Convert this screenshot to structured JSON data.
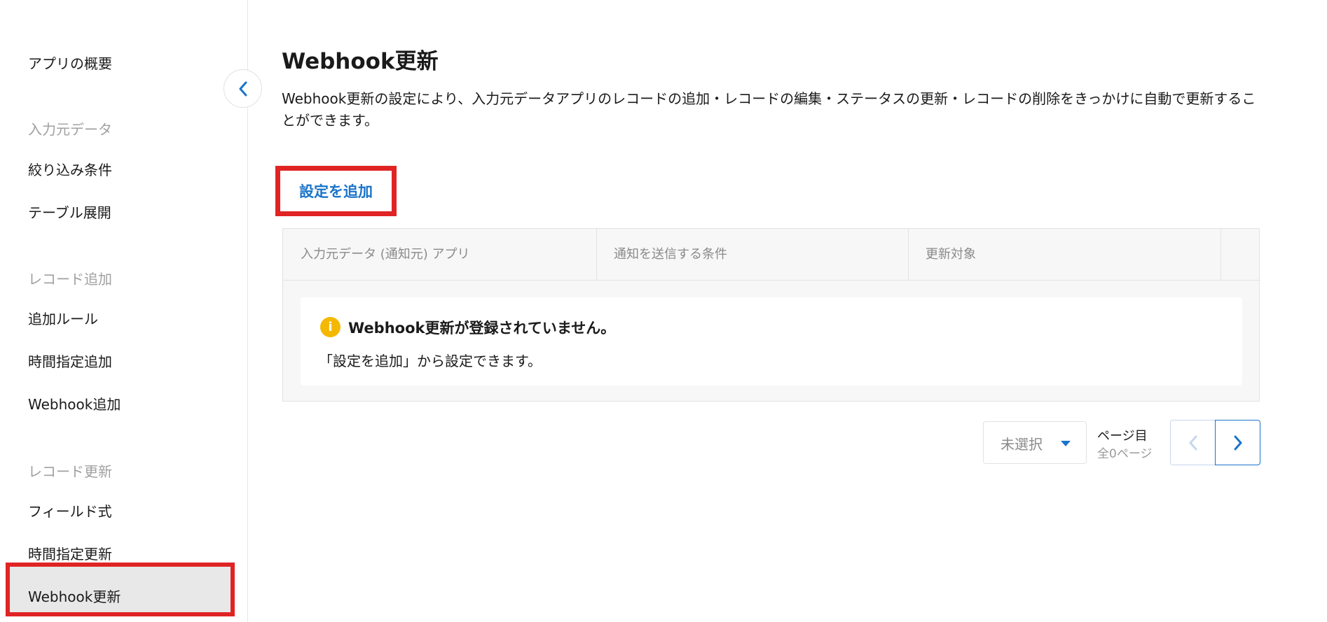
{
  "sidebar": {
    "items": [
      {
        "label": "アプリの概要",
        "type": "item"
      },
      {
        "label": "入力元データ",
        "type": "section"
      },
      {
        "label": "絞り込み条件",
        "type": "item"
      },
      {
        "label": "テーブル展開",
        "type": "item"
      },
      {
        "label": "レコード追加",
        "type": "section"
      },
      {
        "label": "追加ルール",
        "type": "item"
      },
      {
        "label": "時間指定追加",
        "type": "item"
      },
      {
        "label": "Webhook追加",
        "type": "item"
      },
      {
        "label": "レコード更新",
        "type": "section"
      },
      {
        "label": "フィールド式",
        "type": "item"
      },
      {
        "label": "時間指定更新",
        "type": "item"
      },
      {
        "label": "Webhook更新",
        "type": "item",
        "active": true
      }
    ]
  },
  "main": {
    "title": "Webhook更新",
    "description": "Webhook更新の設定により、入力元データアプリのレコードの追加・レコードの編集・ステータスの更新・レコードの削除をきっかけに自動で更新することができます。",
    "add_button_label": "設定を追加",
    "table": {
      "columns": [
        "入力元データ (通知元) アプリ",
        "通知を送信する条件",
        "更新対象"
      ],
      "empty_title": "Webhook更新が登録されていません。",
      "empty_subtitle": "「設定を追加」から設定できます。"
    },
    "pagination": {
      "select_value": "未選択",
      "page_label": "ページ目",
      "total_label": "全0ページ"
    }
  },
  "colors": {
    "accent": "#1a74c9",
    "highlight": "#e02424",
    "info": "#f5b800"
  },
  "icons": {
    "collapse": "chevron-left-icon",
    "info": "info-icon",
    "prev": "chevron-left-icon",
    "next": "chevron-right-icon",
    "dropdown": "caret-down-icon"
  }
}
